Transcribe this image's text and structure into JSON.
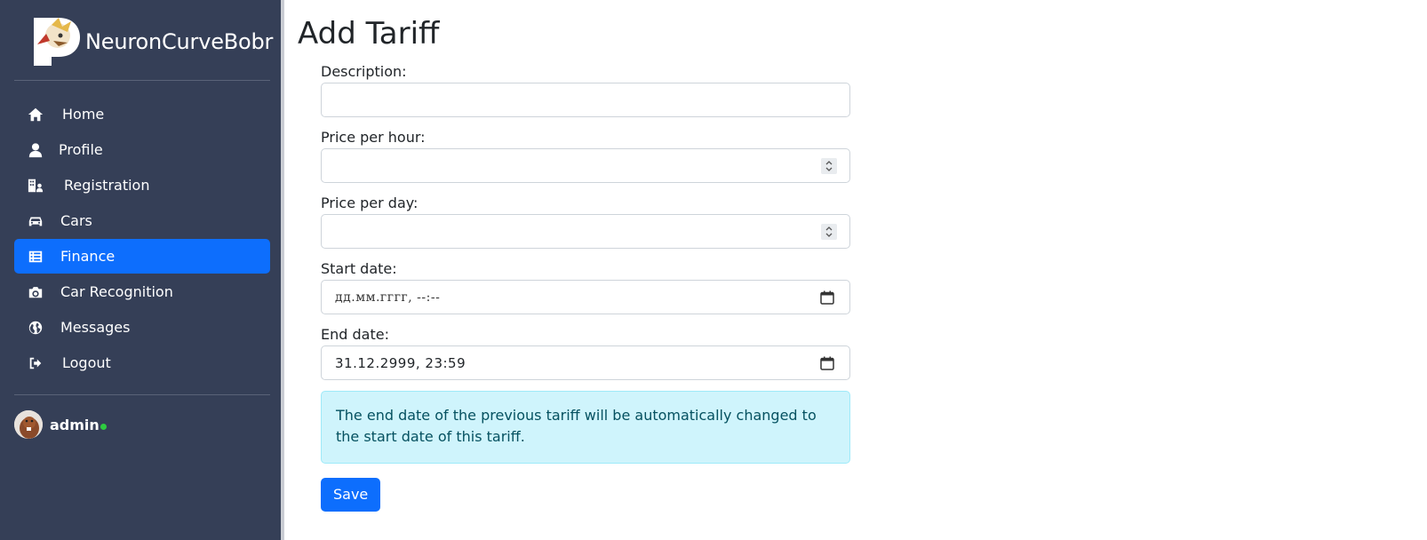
{
  "brand": {
    "name": "NeuronCurveBobr"
  },
  "sidebar": {
    "items": [
      {
        "label": "Home",
        "icon": "home-icon"
      },
      {
        "label": "Profile",
        "icon": "user-icon"
      },
      {
        "label": "Registration",
        "icon": "building-user-icon"
      },
      {
        "label": "Cars",
        "icon": "car-icon"
      },
      {
        "label": "Finance",
        "icon": "table-list-icon",
        "active": true
      },
      {
        "label": "Car Recognition",
        "icon": "camera-icon"
      },
      {
        "label": "Messages",
        "icon": "globe-icon"
      },
      {
        "label": "Logout",
        "icon": "sign-out-icon"
      }
    ],
    "user": {
      "name": "admin",
      "status_color": "#2ecc40"
    }
  },
  "page": {
    "title": "Add Tariff"
  },
  "form": {
    "description": {
      "label": "Description:",
      "value": ""
    },
    "price_hour": {
      "label": "Price per hour:",
      "value": ""
    },
    "price_day": {
      "label": "Price per day:",
      "value": ""
    },
    "start_date": {
      "label": "Start date:",
      "value": "дд.мм.гггг, --:--"
    },
    "end_date": {
      "label": "End date:",
      "value": "31.12.2999, 23:59"
    },
    "notice": "The end date of the previous tariff will be automatically changed to the start date of this tariff.",
    "save_label": "Save"
  },
  "colors": {
    "sidebar_bg": "#353f57",
    "accent": "#0d6efd",
    "alert_bg": "#cff4fc",
    "alert_text": "#055160"
  }
}
